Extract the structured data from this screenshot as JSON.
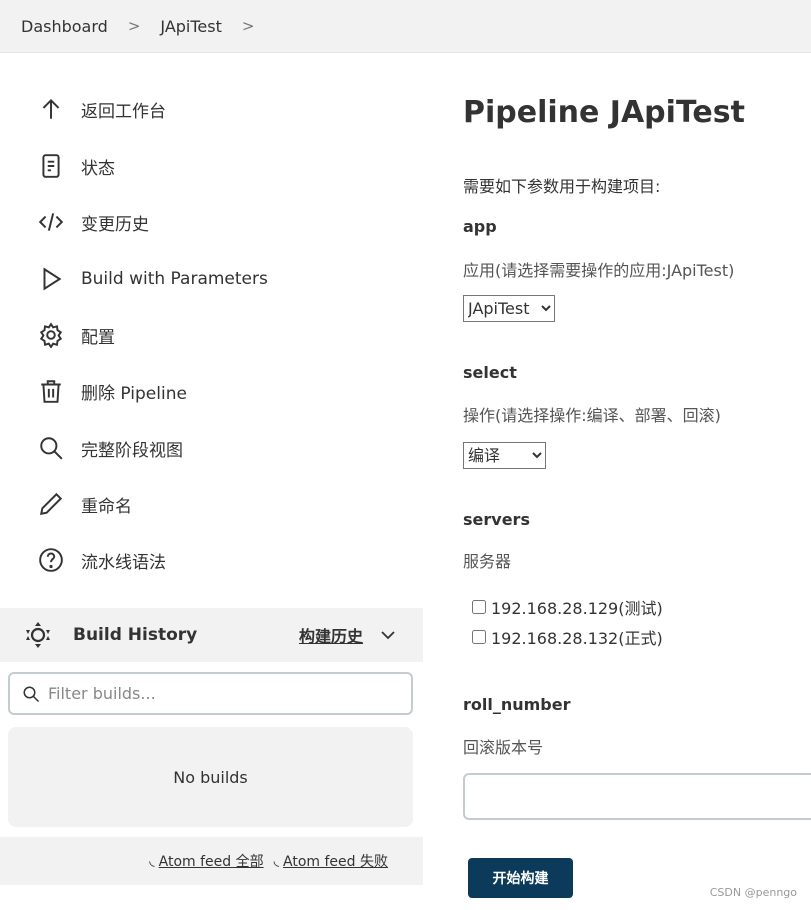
{
  "breadcrumb": [
    "Dashboard",
    "JApiTest"
  ],
  "sidebar": {
    "items": [
      {
        "label": "返回工作台",
        "icon": "arrow-up-icon"
      },
      {
        "label": "状态",
        "icon": "document-icon"
      },
      {
        "label": "变更历史",
        "icon": "code-icon"
      },
      {
        "label": "Build with Parameters",
        "icon": "play-icon"
      },
      {
        "label": "配置",
        "icon": "gear-icon"
      },
      {
        "label": "删除 Pipeline",
        "icon": "trash-icon"
      },
      {
        "label": "完整阶段视图",
        "icon": "search-icon"
      },
      {
        "label": "重命名",
        "icon": "pencil-icon"
      },
      {
        "label": "流水线语法",
        "icon": "help-icon"
      }
    ]
  },
  "build_history": {
    "title": "Build History",
    "trend": "构建历史",
    "filter_placeholder": "Filter builds...",
    "empty": "No builds",
    "feed_all": "Atom feed 全部",
    "feed_failed": "Atom feed 失败"
  },
  "main": {
    "title": "Pipeline JApiTest",
    "intro": "需要如下参数用于构建项目:",
    "params": {
      "app": {
        "name": "app",
        "desc": "应用(请选择需要操作的应用:JApiTest)",
        "value": "JApiTest"
      },
      "select": {
        "name": "select",
        "desc": "操作(请选择操作:编译、部署、回滚)",
        "value": "编译"
      },
      "servers": {
        "name": "servers",
        "desc": "服务器",
        "options": [
          "192.168.28.129(测试)",
          "192.168.28.132(正式)"
        ]
      },
      "roll_number": {
        "name": "roll_number",
        "desc": "回滚版本号",
        "value": ""
      }
    },
    "submit": "开始构建"
  },
  "watermark": "CSDN @penngo",
  "colors": {
    "button": "#0b3a5a",
    "panel": "#f2f2f2"
  }
}
